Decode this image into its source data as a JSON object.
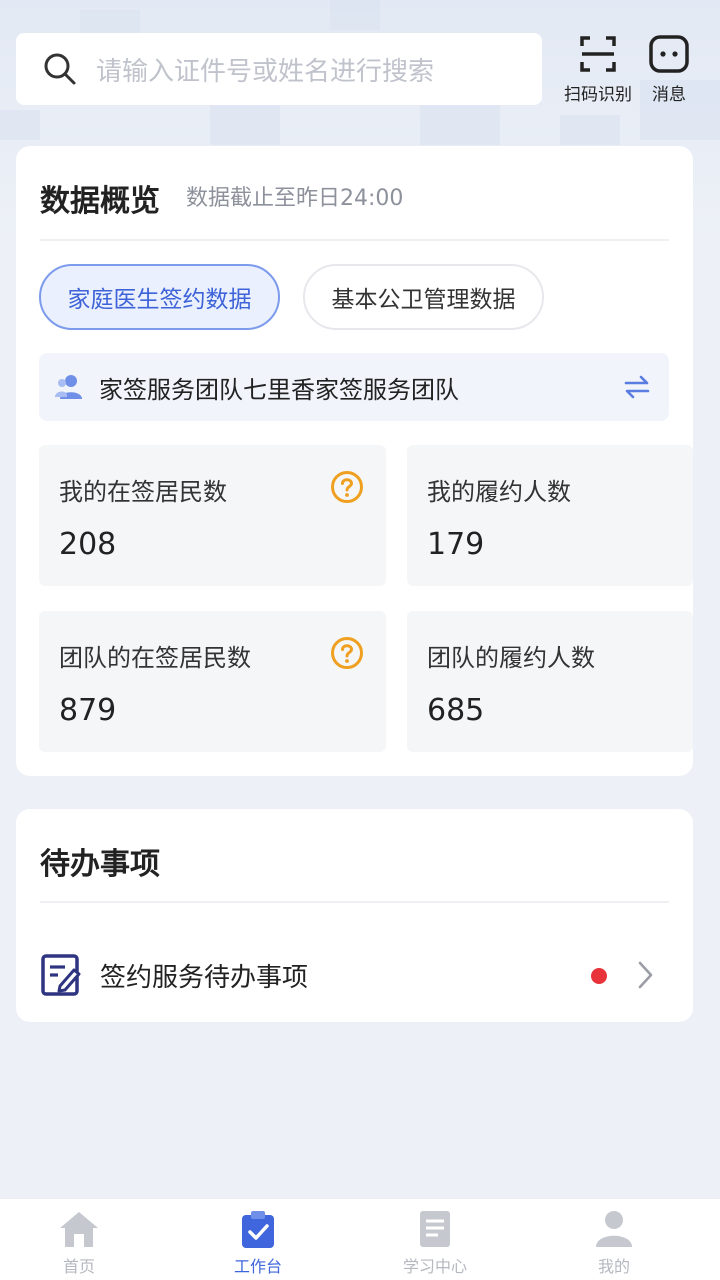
{
  "search": {
    "placeholder": "请输入证件号或姓名进行搜索"
  },
  "header": {
    "scan_label": "扫码识别",
    "message_label": "消息"
  },
  "overview": {
    "title": "数据概览",
    "subtitle": "数据截止至昨日24:00",
    "tabs": [
      {
        "label": "家庭医生签约数据",
        "active": true
      },
      {
        "label": "基本公卫管理数据",
        "active": false
      }
    ],
    "team_name": "家签服务团队七里香家签服务团队",
    "stats": [
      {
        "label": "我的在签居民数",
        "value": "208"
      },
      {
        "label": "我的履约人数",
        "value": "179"
      },
      {
        "label": "团队的在签居民数",
        "value": "879"
      },
      {
        "label": "团队的履约人数",
        "value": "685"
      }
    ]
  },
  "todo": {
    "title": "待办事项",
    "items": [
      {
        "label": "签约服务待办事项"
      }
    ]
  },
  "nav": {
    "items": [
      {
        "label": "首页"
      },
      {
        "label": "工作台"
      },
      {
        "label": "学习中心"
      },
      {
        "label": "我的"
      }
    ]
  },
  "colors": {
    "accent": "#3f66dc",
    "warning": "#f0a020",
    "badge": "#e8333b"
  }
}
